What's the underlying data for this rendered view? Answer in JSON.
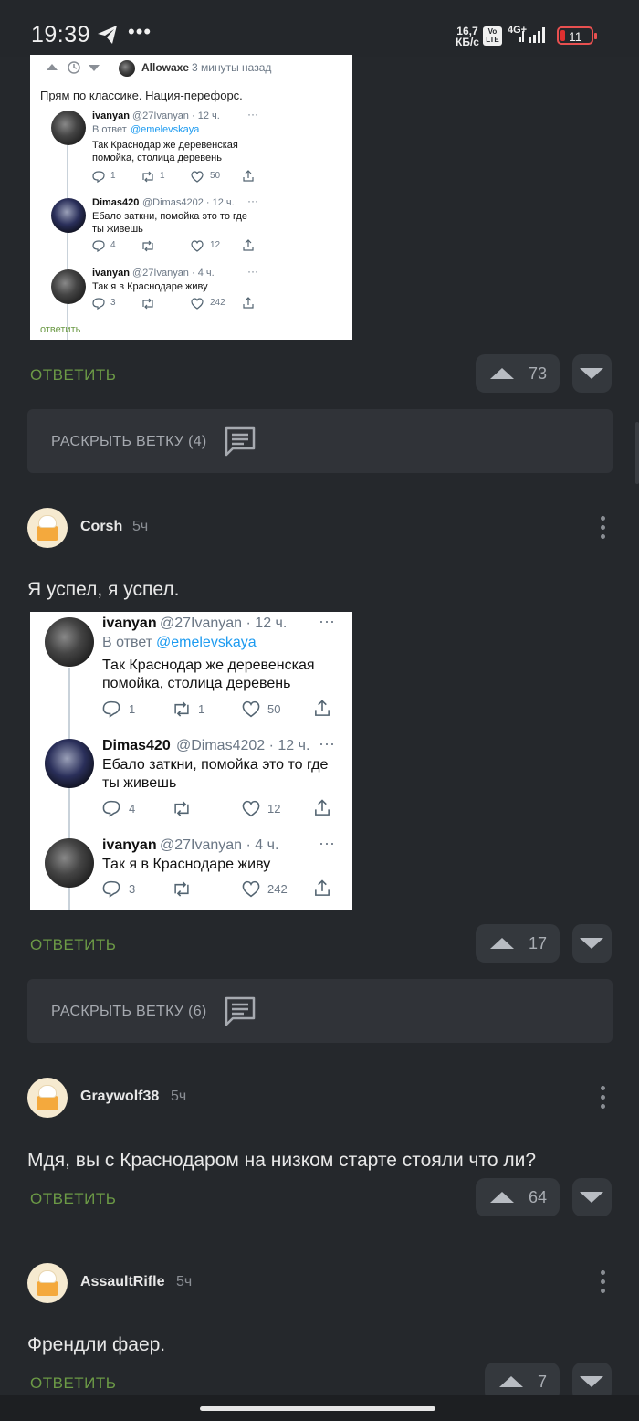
{
  "status_bar": {
    "time": "19:39",
    "dots": "•••",
    "speed_value": "16,7",
    "speed_unit": "КБ/с",
    "volte": "Vo LTE",
    "network": "4G+",
    "battery": "11",
    "battery_color": "#e03030"
  },
  "post1_image": {
    "header_user": "Allowaxe",
    "header_time": "3 минуты назад",
    "comment_text": "Прям по классике. Нация-перефорс.",
    "reply_label": "ответить",
    "tweets": [
      {
        "name": "ivanyan",
        "handle": "@27Ivanyan · 12 ч.",
        "in_reply": "В ответ",
        "mention": "@emelevskaya",
        "text1": "Так Краснодар же деревенская",
        "text2": "помойка, столица деревень",
        "replies": "1",
        "retweets": "1",
        "likes": "50"
      },
      {
        "name": "Dimas420",
        "handle": "@Dimas4202 · 12 ч.",
        "text1": "Ебало заткни, помойка это то где",
        "text2": "ты живешь",
        "replies": "4",
        "likes": "12"
      },
      {
        "name": "ivanyan",
        "handle": "@27Ivanyan · 4 ч.",
        "text1": "Так я в Краснодаре живу",
        "replies": "3",
        "likes": "242"
      }
    ]
  },
  "comments": [
    {
      "reply": "ОТВЕТИТЬ",
      "votes": "73",
      "expand": "РАСКРЫТЬ ВЕТКУ (4)"
    },
    {
      "author": "Corsh",
      "ago": "5ч",
      "text": "Я успел, я успел.",
      "reply": "ОТВЕТИТЬ",
      "votes": "17",
      "expand": "РАСКРЫТЬ ВЕТКУ (6)"
    },
    {
      "author": "Graywolf38",
      "ago": "5ч",
      "text": "Мдя, вы с Краснодаром на низком старте стояли что ли?",
      "reply": "ОТВЕТИТЬ",
      "votes": "64"
    },
    {
      "author": "AssaultRifle",
      "ago": "5ч",
      "text": "Френдли фаер.",
      "reply": "ОТВЕТИТЬ",
      "votes": "7"
    }
  ],
  "post2_image": {
    "tweets": [
      {
        "name": "ivanyan",
        "handle": "@27Ivanyan · 12 ч.",
        "in_reply": "В ответ",
        "mention": "@emelevskaya",
        "text1": "Так Краснодар же деревенская",
        "text2": "помойка, столица деревень",
        "replies": "1",
        "retweets": "1",
        "likes": "50"
      },
      {
        "name": "Dimas420",
        "handle": "@Dimas4202 · 12 ч.",
        "text1": "Ебало заткни, помойка это то где",
        "text2": "ты живешь",
        "replies": "4",
        "likes": "12"
      },
      {
        "name": "ivanyan",
        "handle": "@27Ivanyan · 4 ч.",
        "text1": "Так я в Краснодаре живу",
        "replies": "3",
        "likes": "242"
      }
    ]
  },
  "colors": {
    "background": "#25282c",
    "reply_link": "#6c9a46",
    "mention": "#1d9bf0"
  }
}
